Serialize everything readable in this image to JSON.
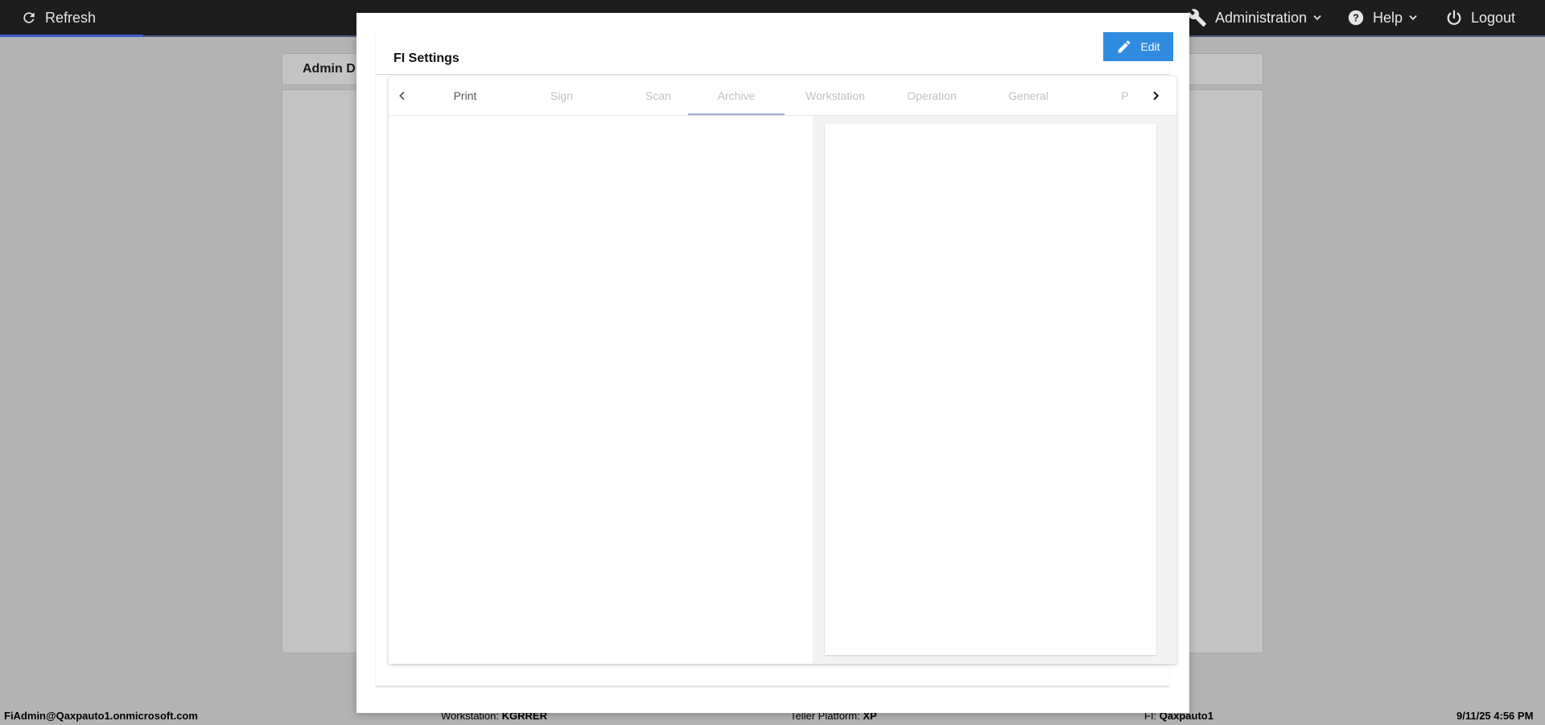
{
  "topbar": {
    "refresh_label": "Refresh",
    "administration_label": "Administration",
    "help_label": "Help",
    "logout_label": "Logout"
  },
  "background": {
    "header_title": "Admin D"
  },
  "modal": {
    "title": "FI Settings",
    "edit_label": "Edit",
    "tabs": [
      {
        "label": "Print"
      },
      {
        "label": "Sign"
      },
      {
        "label": "Scan"
      },
      {
        "label": "Archive"
      },
      {
        "label": "Workstation"
      },
      {
        "label": "Operation"
      },
      {
        "label": "General"
      },
      {
        "label": "P"
      }
    ]
  },
  "statusbar": {
    "user": "FiAdmin@Qaxpauto1.onmicrosoft.com",
    "workstation_label": "Workstation:",
    "workstation_value": "KGRRER",
    "platform_label": "Teller Platform:",
    "platform_value": "XP",
    "fi_label": "FI:",
    "fi_value": "Qaxpauto1",
    "datetime": "9/11/25 4:56 PM"
  },
  "colors": {
    "accent": "#2f8be0",
    "topbar_bg": "#1d1d1d",
    "overlay": "#b3b3b3",
    "tab_indicator": "#9fb0d8"
  }
}
